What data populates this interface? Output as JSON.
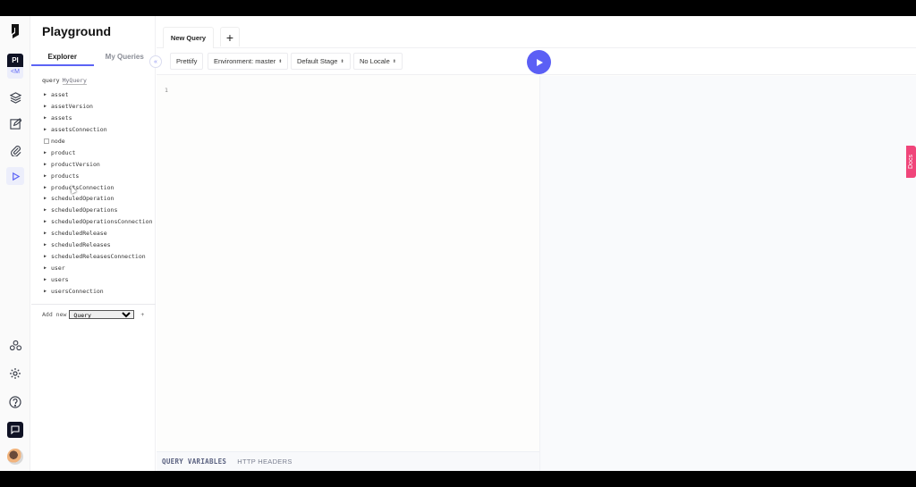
{
  "sidebar_rail": {
    "project_initials": "Pl",
    "project_sub": "<M",
    "icons": [
      "logo-icon",
      "schema-icon",
      "content-icon",
      "assets-icon",
      "playground-icon",
      "webhooks-icon",
      "settings-icon",
      "help-icon",
      "chat-icon",
      "avatar"
    ]
  },
  "explorer": {
    "title": "Playground",
    "tabs": [
      {
        "label": "Explorer",
        "active": true
      },
      {
        "label": "My Queries",
        "active": false
      }
    ],
    "operation_keyword": "query",
    "operation_name": "MyQuery",
    "fields": [
      {
        "name": "asset",
        "type": "arrow"
      },
      {
        "name": "assetVersion",
        "type": "arrow"
      },
      {
        "name": "assets",
        "type": "arrow"
      },
      {
        "name": "assetsConnection",
        "type": "arrow"
      },
      {
        "name": "node",
        "type": "checkbox"
      },
      {
        "name": "product",
        "type": "arrow"
      },
      {
        "name": "productVersion",
        "type": "arrow"
      },
      {
        "name": "products",
        "type": "arrow"
      },
      {
        "name": "productsConnection",
        "type": "arrow"
      },
      {
        "name": "scheduledOperation",
        "type": "arrow"
      },
      {
        "name": "scheduledOperations",
        "type": "arrow"
      },
      {
        "name": "scheduledOperationsConnection",
        "type": "arrow"
      },
      {
        "name": "scheduledRelease",
        "type": "arrow"
      },
      {
        "name": "scheduledReleases",
        "type": "arrow"
      },
      {
        "name": "scheduledReleasesConnection",
        "type": "arrow"
      },
      {
        "name": "user",
        "type": "arrow"
      },
      {
        "name": "users",
        "type": "arrow"
      },
      {
        "name": "usersConnection",
        "type": "arrow"
      }
    ],
    "add_new_label": "Add new",
    "add_new_selected": "Query",
    "add_new_plus": "+"
  },
  "editor": {
    "tab_label": "New Query",
    "add_tab": "+",
    "collapse_icon": "«",
    "toolbar": {
      "prettify": "Prettify",
      "environment": "Environment: master",
      "stage": "Default Stage",
      "locale": "No Locale",
      "select_icon": "⬍"
    },
    "line_numbers": [
      "1"
    ],
    "bottom_tabs": {
      "variables": "QUERY VARIABLES",
      "headers": "HTTP HEADERS"
    },
    "docs_label": "Docs"
  }
}
